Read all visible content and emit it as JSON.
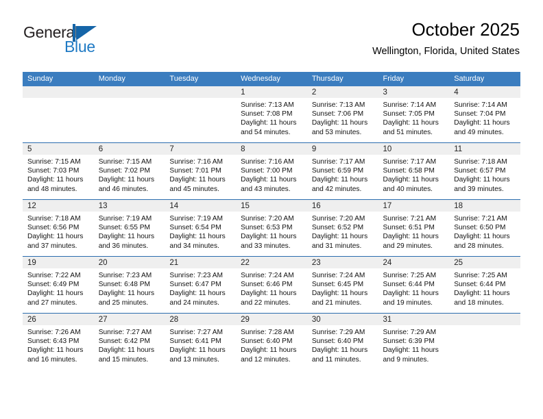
{
  "brand": {
    "name_part1": "General",
    "name_part2": "Blue",
    "logo_icon": "triangle-flag-icon",
    "accent_color": "#1f7ac4"
  },
  "header": {
    "title": "October 2025",
    "subtitle": "Wellington, Florida, United States"
  },
  "calendar": {
    "header_bg": "#3b7dbf",
    "daynum_bg": "#efefef",
    "weekday_headers": [
      "Sunday",
      "Monday",
      "Tuesday",
      "Wednesday",
      "Thursday",
      "Friday",
      "Saturday"
    ],
    "weeks": [
      [
        {
          "day": "",
          "sunrise": "",
          "sunset": "",
          "daylight1": "",
          "daylight2": "",
          "empty": true
        },
        {
          "day": "",
          "sunrise": "",
          "sunset": "",
          "daylight1": "",
          "daylight2": "",
          "empty": true
        },
        {
          "day": "",
          "sunrise": "",
          "sunset": "",
          "daylight1": "",
          "daylight2": "",
          "empty": true
        },
        {
          "day": "1",
          "sunrise": "Sunrise: 7:13 AM",
          "sunset": "Sunset: 7:08 PM",
          "daylight1": "Daylight: 11 hours",
          "daylight2": "and 54 minutes."
        },
        {
          "day": "2",
          "sunrise": "Sunrise: 7:13 AM",
          "sunset": "Sunset: 7:06 PM",
          "daylight1": "Daylight: 11 hours",
          "daylight2": "and 53 minutes."
        },
        {
          "day": "3",
          "sunrise": "Sunrise: 7:14 AM",
          "sunset": "Sunset: 7:05 PM",
          "daylight1": "Daylight: 11 hours",
          "daylight2": "and 51 minutes."
        },
        {
          "day": "4",
          "sunrise": "Sunrise: 7:14 AM",
          "sunset": "Sunset: 7:04 PM",
          "daylight1": "Daylight: 11 hours",
          "daylight2": "and 49 minutes."
        }
      ],
      [
        {
          "day": "5",
          "sunrise": "Sunrise: 7:15 AM",
          "sunset": "Sunset: 7:03 PM",
          "daylight1": "Daylight: 11 hours",
          "daylight2": "and 48 minutes."
        },
        {
          "day": "6",
          "sunrise": "Sunrise: 7:15 AM",
          "sunset": "Sunset: 7:02 PM",
          "daylight1": "Daylight: 11 hours",
          "daylight2": "and 46 minutes."
        },
        {
          "day": "7",
          "sunrise": "Sunrise: 7:16 AM",
          "sunset": "Sunset: 7:01 PM",
          "daylight1": "Daylight: 11 hours",
          "daylight2": "and 45 minutes."
        },
        {
          "day": "8",
          "sunrise": "Sunrise: 7:16 AM",
          "sunset": "Sunset: 7:00 PM",
          "daylight1": "Daylight: 11 hours",
          "daylight2": "and 43 minutes."
        },
        {
          "day": "9",
          "sunrise": "Sunrise: 7:17 AM",
          "sunset": "Sunset: 6:59 PM",
          "daylight1": "Daylight: 11 hours",
          "daylight2": "and 42 minutes."
        },
        {
          "day": "10",
          "sunrise": "Sunrise: 7:17 AM",
          "sunset": "Sunset: 6:58 PM",
          "daylight1": "Daylight: 11 hours",
          "daylight2": "and 40 minutes."
        },
        {
          "day": "11",
          "sunrise": "Sunrise: 7:18 AM",
          "sunset": "Sunset: 6:57 PM",
          "daylight1": "Daylight: 11 hours",
          "daylight2": "and 39 minutes."
        }
      ],
      [
        {
          "day": "12",
          "sunrise": "Sunrise: 7:18 AM",
          "sunset": "Sunset: 6:56 PM",
          "daylight1": "Daylight: 11 hours",
          "daylight2": "and 37 minutes."
        },
        {
          "day": "13",
          "sunrise": "Sunrise: 7:19 AM",
          "sunset": "Sunset: 6:55 PM",
          "daylight1": "Daylight: 11 hours",
          "daylight2": "and 36 minutes."
        },
        {
          "day": "14",
          "sunrise": "Sunrise: 7:19 AM",
          "sunset": "Sunset: 6:54 PM",
          "daylight1": "Daylight: 11 hours",
          "daylight2": "and 34 minutes."
        },
        {
          "day": "15",
          "sunrise": "Sunrise: 7:20 AM",
          "sunset": "Sunset: 6:53 PM",
          "daylight1": "Daylight: 11 hours",
          "daylight2": "and 33 minutes."
        },
        {
          "day": "16",
          "sunrise": "Sunrise: 7:20 AM",
          "sunset": "Sunset: 6:52 PM",
          "daylight1": "Daylight: 11 hours",
          "daylight2": "and 31 minutes."
        },
        {
          "day": "17",
          "sunrise": "Sunrise: 7:21 AM",
          "sunset": "Sunset: 6:51 PM",
          "daylight1": "Daylight: 11 hours",
          "daylight2": "and 29 minutes."
        },
        {
          "day": "18",
          "sunrise": "Sunrise: 7:21 AM",
          "sunset": "Sunset: 6:50 PM",
          "daylight1": "Daylight: 11 hours",
          "daylight2": "and 28 minutes."
        }
      ],
      [
        {
          "day": "19",
          "sunrise": "Sunrise: 7:22 AM",
          "sunset": "Sunset: 6:49 PM",
          "daylight1": "Daylight: 11 hours",
          "daylight2": "and 27 minutes."
        },
        {
          "day": "20",
          "sunrise": "Sunrise: 7:23 AM",
          "sunset": "Sunset: 6:48 PM",
          "daylight1": "Daylight: 11 hours",
          "daylight2": "and 25 minutes."
        },
        {
          "day": "21",
          "sunrise": "Sunrise: 7:23 AM",
          "sunset": "Sunset: 6:47 PM",
          "daylight1": "Daylight: 11 hours",
          "daylight2": "and 24 minutes."
        },
        {
          "day": "22",
          "sunrise": "Sunrise: 7:24 AM",
          "sunset": "Sunset: 6:46 PM",
          "daylight1": "Daylight: 11 hours",
          "daylight2": "and 22 minutes."
        },
        {
          "day": "23",
          "sunrise": "Sunrise: 7:24 AM",
          "sunset": "Sunset: 6:45 PM",
          "daylight1": "Daylight: 11 hours",
          "daylight2": "and 21 minutes."
        },
        {
          "day": "24",
          "sunrise": "Sunrise: 7:25 AM",
          "sunset": "Sunset: 6:44 PM",
          "daylight1": "Daylight: 11 hours",
          "daylight2": "and 19 minutes."
        },
        {
          "day": "25",
          "sunrise": "Sunrise: 7:25 AM",
          "sunset": "Sunset: 6:44 PM",
          "daylight1": "Daylight: 11 hours",
          "daylight2": "and 18 minutes."
        }
      ],
      [
        {
          "day": "26",
          "sunrise": "Sunrise: 7:26 AM",
          "sunset": "Sunset: 6:43 PM",
          "daylight1": "Daylight: 11 hours",
          "daylight2": "and 16 minutes."
        },
        {
          "day": "27",
          "sunrise": "Sunrise: 7:27 AM",
          "sunset": "Sunset: 6:42 PM",
          "daylight1": "Daylight: 11 hours",
          "daylight2": "and 15 minutes."
        },
        {
          "day": "28",
          "sunrise": "Sunrise: 7:27 AM",
          "sunset": "Sunset: 6:41 PM",
          "daylight1": "Daylight: 11 hours",
          "daylight2": "and 13 minutes."
        },
        {
          "day": "29",
          "sunrise": "Sunrise: 7:28 AM",
          "sunset": "Sunset: 6:40 PM",
          "daylight1": "Daylight: 11 hours",
          "daylight2": "and 12 minutes."
        },
        {
          "day": "30",
          "sunrise": "Sunrise: 7:29 AM",
          "sunset": "Sunset: 6:40 PM",
          "daylight1": "Daylight: 11 hours",
          "daylight2": "and 11 minutes."
        },
        {
          "day": "31",
          "sunrise": "Sunrise: 7:29 AM",
          "sunset": "Sunset: 6:39 PM",
          "daylight1": "Daylight: 11 hours",
          "daylight2": "and 9 minutes."
        },
        {
          "day": "",
          "sunrise": "",
          "sunset": "",
          "daylight1": "",
          "daylight2": "",
          "empty": true
        }
      ]
    ]
  }
}
